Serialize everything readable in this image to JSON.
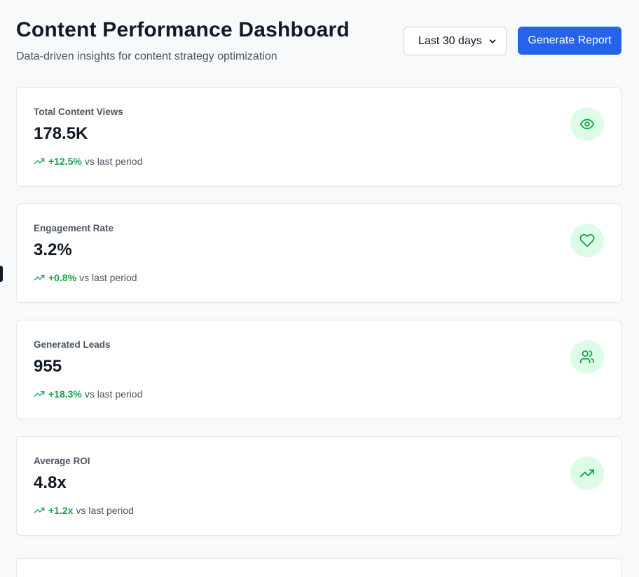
{
  "header": {
    "title": "Content Performance Dashboard",
    "subtitle": "Data-driven insights for content strategy optimization",
    "period_select": {
      "value": "Last 30 days"
    },
    "generate_label": "Generate Report"
  },
  "colors": {
    "accent": "#2563eb",
    "positive": "#16a34a",
    "icon_bg": "#dcfce7"
  },
  "metrics": [
    {
      "label": "Total Content Views",
      "value": "178.5K",
      "change": "+12.5%",
      "suffix": "vs last period",
      "icon": "eye-icon"
    },
    {
      "label": "Engagement Rate",
      "value": "3.2%",
      "change": "+0.8%",
      "suffix": "vs last period",
      "icon": "heart-icon"
    },
    {
      "label": "Generated Leads",
      "value": "955",
      "change": "+18.3%",
      "suffix": "vs last period",
      "icon": "users-icon"
    },
    {
      "label": "Average ROI",
      "value": "4.8x",
      "change": "+1.2x",
      "suffix": "vs last period",
      "icon": "trending-up-icon"
    }
  ]
}
